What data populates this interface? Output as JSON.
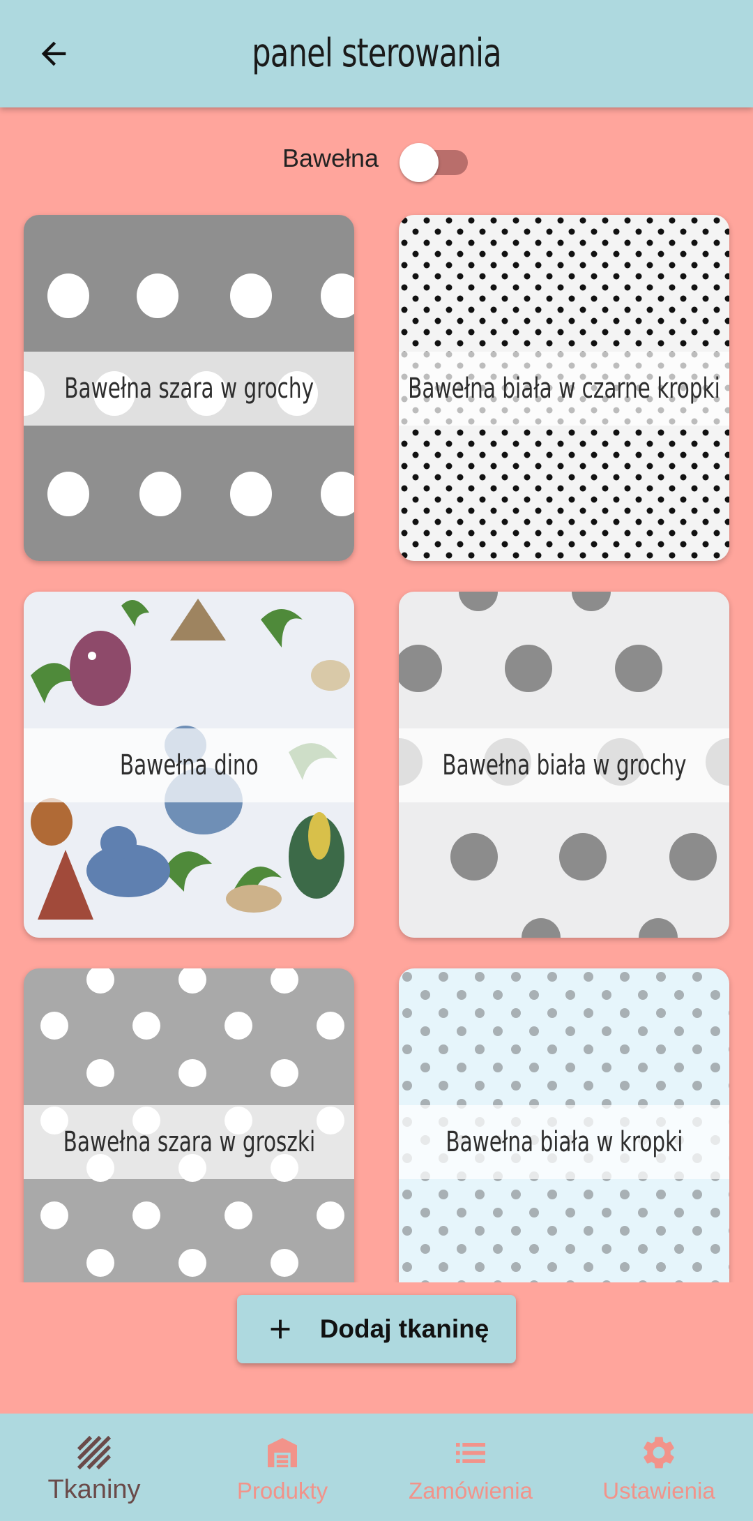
{
  "header": {
    "title": "panel sterowania",
    "back_icon": "arrow-left-icon"
  },
  "filter": {
    "label": "Bawełna",
    "toggle_on": false
  },
  "fabrics": [
    {
      "name": "Bawełna szara w grochy"
    },
    {
      "name": "Bawełna biała w czarne kropki"
    },
    {
      "name": "Bawełna dino"
    },
    {
      "name": "Bawełna biała w grochy"
    },
    {
      "name": "Bawełna szara w groszki"
    },
    {
      "name": "Bawełna biała w kropki"
    }
  ],
  "add_button": {
    "label": "Dodaj tkaninę",
    "icon": "plus-icon"
  },
  "bottom_nav": {
    "items": [
      {
        "label": "Tkaniny",
        "icon": "fabric-stripes-icon",
        "active": true
      },
      {
        "label": "Produkty",
        "icon": "warehouse-icon",
        "active": false
      },
      {
        "label": "Zamówienia",
        "icon": "list-icon",
        "active": false
      },
      {
        "label": "Ustawienia",
        "icon": "gear-icon",
        "active": false
      }
    ]
  },
  "colors": {
    "background": "#ffa59c",
    "bar": "#aed9df",
    "nav_inactive": "#f2938a",
    "nav_active": "#6a4a49"
  }
}
